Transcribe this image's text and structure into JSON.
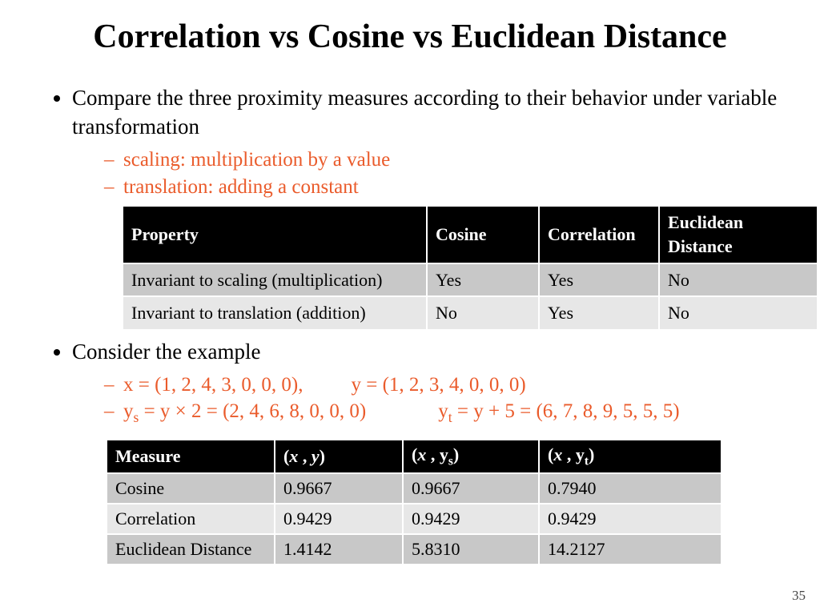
{
  "title": "Correlation vs Cosine vs Euclidean Distance",
  "bullets": {
    "b1": "Compare the three proximity measures according to their behavior under variable transformation",
    "b1a": "scaling: multiplication by a value",
    "b1b": "translation: adding a constant",
    "b2": "Consider the example",
    "b2a_x": "x = (1, 2, 4, 3, 0, 0, 0),",
    "b2a_y": "y = (1, 2, 3, 4, 0, 0, 0)",
    "b2b_ys": "y",
    "b2b_ys_sub": "s",
    "b2b_ys_rest": "  = y × 2 = (2, 4, 6, 8, 0, 0, 0)",
    "b2b_yt": "y",
    "b2b_yt_sub": "t",
    "b2b_yt_rest": "  = y + 5 = (6, 7, 8, 9, 5, 5, 5)"
  },
  "table1": {
    "headers": [
      "Property",
      "Cosine",
      "Correlation",
      "Euclidean Distance"
    ],
    "rows": [
      [
        "Invariant to scaling (multiplication)",
        "Yes",
        "Yes",
        "No"
      ],
      [
        "Invariant to translation (addition)",
        "No",
        "Yes",
        "No"
      ]
    ]
  },
  "table2": {
    "h0": "Measure",
    "h1_pre": "(",
    "h1_x": "x ",
    "h1_mid": ", ",
    "h1_y": "y",
    "h1_post": ")",
    "h2_pre": "(",
    "h2_x": "x ",
    "h2_mid": ", y",
    "h2_sub": "s",
    "h2_post": ")",
    "h3_pre": "(",
    "h3_x": "x ",
    "h3_mid": ", y",
    "h3_sub": "t",
    "h3_post": ")",
    "rows": [
      [
        "Cosine",
        "0.9667",
        "0.9667",
        "0.7940"
      ],
      [
        "Correlation",
        "0.9429",
        "0.9429",
        "0.9429"
      ],
      [
        "Euclidean Distance",
        "1.4142",
        "5.8310",
        "14.2127"
      ]
    ]
  },
  "page": "35",
  "chart_data": [
    {
      "type": "table",
      "title": "Invariance properties",
      "columns": [
        "Property",
        "Cosine",
        "Correlation",
        "Euclidean Distance"
      ],
      "rows": [
        {
          "Property": "Invariant to scaling (multiplication)",
          "Cosine": "Yes",
          "Correlation": "Yes",
          "Euclidean Distance": "No"
        },
        {
          "Property": "Invariant to translation (addition)",
          "Cosine": "No",
          "Correlation": "Yes",
          "Euclidean Distance": "No"
        }
      ]
    },
    {
      "type": "table",
      "title": "Measure values",
      "columns": [
        "Measure",
        "(x , y)",
        "(x , y_s)",
        "(x , y_t)"
      ],
      "rows": [
        {
          "Measure": "Cosine",
          "(x , y)": 0.9667,
          "(x , y_s)": 0.9667,
          "(x , y_t)": 0.794
        },
        {
          "Measure": "Correlation",
          "(x , y)": 0.9429,
          "(x , y_s)": 0.9429,
          "(x , y_t)": 0.9429
        },
        {
          "Measure": "Euclidean Distance",
          "(x , y)": 1.4142,
          "(x , y_s)": 5.831,
          "(x , y_t)": 14.2127
        }
      ]
    }
  ]
}
